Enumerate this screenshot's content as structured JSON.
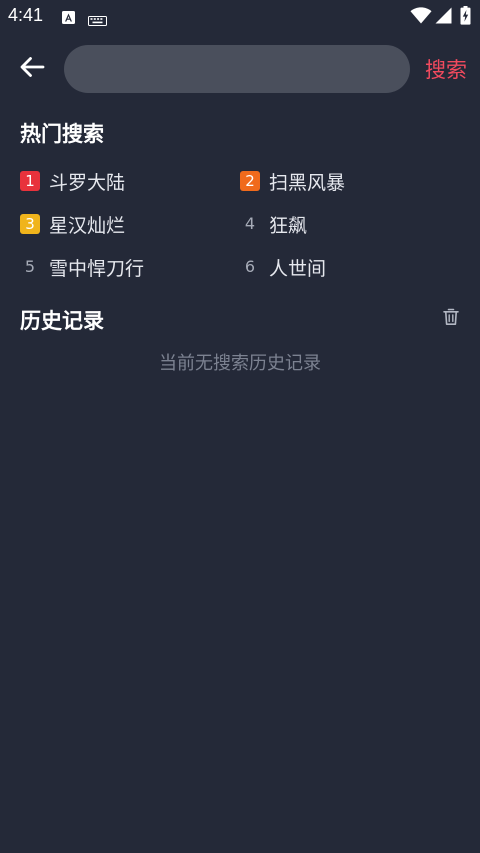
{
  "status_bar": {
    "time": "4:41",
    "icons": [
      "accessibility-a-icon",
      "keyboard-icon",
      "wifi-icon",
      "cell-signal-icon",
      "battery-charging-icon"
    ]
  },
  "header": {
    "back_icon": "arrow-left-icon",
    "search_placeholder": "",
    "search_value": "",
    "search_button_label": "搜索"
  },
  "hot_search": {
    "title": "热门搜索",
    "items": [
      {
        "rank": "1",
        "label": "斗罗大陆",
        "badge_color": "#e8323c"
      },
      {
        "rank": "2",
        "label": "扫黑风暴",
        "badge_color": "#f06a1c"
      },
      {
        "rank": "3",
        "label": "星汉灿烂",
        "badge_color": "#f0b41c"
      },
      {
        "rank": "4",
        "label": "狂飙"
      },
      {
        "rank": "5",
        "label": "雪中悍刀行"
      },
      {
        "rank": "6",
        "label": "人世间"
      }
    ]
  },
  "history": {
    "title": "历史记录",
    "clear_icon": "trash-icon",
    "empty_text": "当前无搜索历史记录"
  },
  "colors": {
    "background": "#242938",
    "accent": "#f24a5e",
    "input_bg": "#4a4f5c"
  }
}
